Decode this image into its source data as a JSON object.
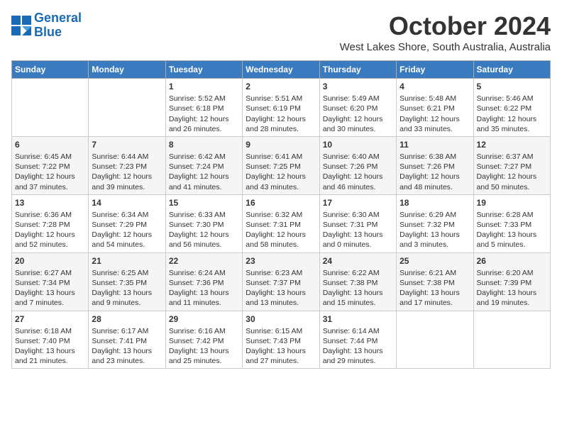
{
  "header": {
    "logo_line1": "General",
    "logo_line2": "Blue",
    "month": "October 2024",
    "location": "West Lakes Shore, South Australia, Australia"
  },
  "weekdays": [
    "Sunday",
    "Monday",
    "Tuesday",
    "Wednesday",
    "Thursday",
    "Friday",
    "Saturday"
  ],
  "weeks": [
    [
      {
        "day": "",
        "info": ""
      },
      {
        "day": "",
        "info": ""
      },
      {
        "day": "1",
        "info": "Sunrise: 5:52 AM\nSunset: 6:18 PM\nDaylight: 12 hours\nand 26 minutes."
      },
      {
        "day": "2",
        "info": "Sunrise: 5:51 AM\nSunset: 6:19 PM\nDaylight: 12 hours\nand 28 minutes."
      },
      {
        "day": "3",
        "info": "Sunrise: 5:49 AM\nSunset: 6:20 PM\nDaylight: 12 hours\nand 30 minutes."
      },
      {
        "day": "4",
        "info": "Sunrise: 5:48 AM\nSunset: 6:21 PM\nDaylight: 12 hours\nand 33 minutes."
      },
      {
        "day": "5",
        "info": "Sunrise: 5:46 AM\nSunset: 6:22 PM\nDaylight: 12 hours\nand 35 minutes."
      }
    ],
    [
      {
        "day": "6",
        "info": "Sunrise: 6:45 AM\nSunset: 7:22 PM\nDaylight: 12 hours\nand 37 minutes."
      },
      {
        "day": "7",
        "info": "Sunrise: 6:44 AM\nSunset: 7:23 PM\nDaylight: 12 hours\nand 39 minutes."
      },
      {
        "day": "8",
        "info": "Sunrise: 6:42 AM\nSunset: 7:24 PM\nDaylight: 12 hours\nand 41 minutes."
      },
      {
        "day": "9",
        "info": "Sunrise: 6:41 AM\nSunset: 7:25 PM\nDaylight: 12 hours\nand 43 minutes."
      },
      {
        "day": "10",
        "info": "Sunrise: 6:40 AM\nSunset: 7:26 PM\nDaylight: 12 hours\nand 46 minutes."
      },
      {
        "day": "11",
        "info": "Sunrise: 6:38 AM\nSunset: 7:26 PM\nDaylight: 12 hours\nand 48 minutes."
      },
      {
        "day": "12",
        "info": "Sunrise: 6:37 AM\nSunset: 7:27 PM\nDaylight: 12 hours\nand 50 minutes."
      }
    ],
    [
      {
        "day": "13",
        "info": "Sunrise: 6:36 AM\nSunset: 7:28 PM\nDaylight: 12 hours\nand 52 minutes."
      },
      {
        "day": "14",
        "info": "Sunrise: 6:34 AM\nSunset: 7:29 PM\nDaylight: 12 hours\nand 54 minutes."
      },
      {
        "day": "15",
        "info": "Sunrise: 6:33 AM\nSunset: 7:30 PM\nDaylight: 12 hours\nand 56 minutes."
      },
      {
        "day": "16",
        "info": "Sunrise: 6:32 AM\nSunset: 7:31 PM\nDaylight: 12 hours\nand 58 minutes."
      },
      {
        "day": "17",
        "info": "Sunrise: 6:30 AM\nSunset: 7:31 PM\nDaylight: 13 hours\nand 0 minutes."
      },
      {
        "day": "18",
        "info": "Sunrise: 6:29 AM\nSunset: 7:32 PM\nDaylight: 13 hours\nand 3 minutes."
      },
      {
        "day": "19",
        "info": "Sunrise: 6:28 AM\nSunset: 7:33 PM\nDaylight: 13 hours\nand 5 minutes."
      }
    ],
    [
      {
        "day": "20",
        "info": "Sunrise: 6:27 AM\nSunset: 7:34 PM\nDaylight: 13 hours\nand 7 minutes."
      },
      {
        "day": "21",
        "info": "Sunrise: 6:25 AM\nSunset: 7:35 PM\nDaylight: 13 hours\nand 9 minutes."
      },
      {
        "day": "22",
        "info": "Sunrise: 6:24 AM\nSunset: 7:36 PM\nDaylight: 13 hours\nand 11 minutes."
      },
      {
        "day": "23",
        "info": "Sunrise: 6:23 AM\nSunset: 7:37 PM\nDaylight: 13 hours\nand 13 minutes."
      },
      {
        "day": "24",
        "info": "Sunrise: 6:22 AM\nSunset: 7:38 PM\nDaylight: 13 hours\nand 15 minutes."
      },
      {
        "day": "25",
        "info": "Sunrise: 6:21 AM\nSunset: 7:38 PM\nDaylight: 13 hours\nand 17 minutes."
      },
      {
        "day": "26",
        "info": "Sunrise: 6:20 AM\nSunset: 7:39 PM\nDaylight: 13 hours\nand 19 minutes."
      }
    ],
    [
      {
        "day": "27",
        "info": "Sunrise: 6:18 AM\nSunset: 7:40 PM\nDaylight: 13 hours\nand 21 minutes."
      },
      {
        "day": "28",
        "info": "Sunrise: 6:17 AM\nSunset: 7:41 PM\nDaylight: 13 hours\nand 23 minutes."
      },
      {
        "day": "29",
        "info": "Sunrise: 6:16 AM\nSunset: 7:42 PM\nDaylight: 13 hours\nand 25 minutes."
      },
      {
        "day": "30",
        "info": "Sunrise: 6:15 AM\nSunset: 7:43 PM\nDaylight: 13 hours\nand 27 minutes."
      },
      {
        "day": "31",
        "info": "Sunrise: 6:14 AM\nSunset: 7:44 PM\nDaylight: 13 hours\nand 29 minutes."
      },
      {
        "day": "",
        "info": ""
      },
      {
        "day": "",
        "info": ""
      }
    ]
  ]
}
